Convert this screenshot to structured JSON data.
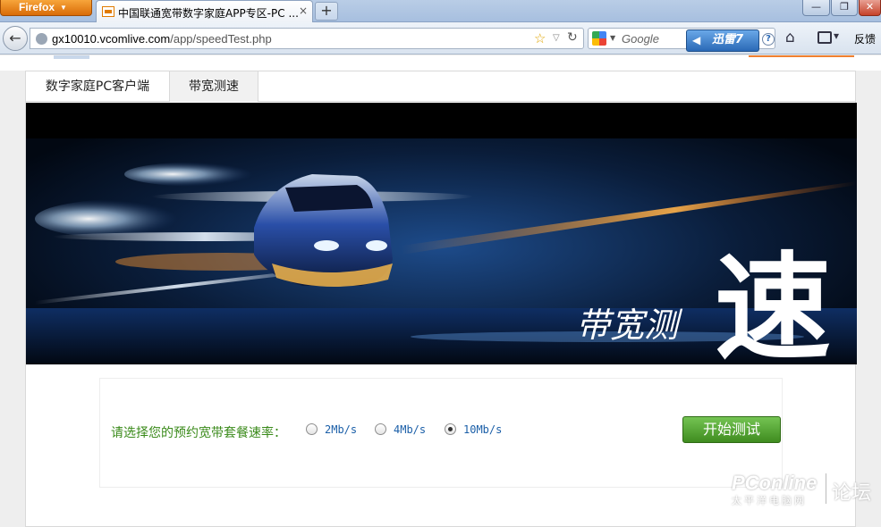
{
  "browser": {
    "app_button": "Firefox",
    "tab_title": "中国联通宽带数字家庭APP专区-PC ...",
    "tab_close": "×",
    "new_tab": "+",
    "url_host": "gx10010.vcomlive.com",
    "url_path": "/app/speedTest.php",
    "search_placeholder": "Google",
    "xunlei_label": "迅雷7",
    "help": "?",
    "feedback": "反馈",
    "window_buttons": {
      "minimize": "—",
      "maximize": "❐",
      "close": "✕"
    }
  },
  "page": {
    "tabs": [
      {
        "label": "数字家庭PC客户端"
      },
      {
        "label": "带宽测速"
      }
    ],
    "banner_caption": "带宽测",
    "banner_big_char": "速",
    "speed": {
      "prompt": "请选择您的预约宽带套餐速率：",
      "options": [
        {
          "label": "2Mb/s",
          "selected": false
        },
        {
          "label": "4Mb/s",
          "selected": false
        },
        {
          "label": "10Mb/s",
          "selected": true
        }
      ],
      "start_button": "开始测试"
    }
  },
  "watermark": {
    "brand": "PConline",
    "sub": "太平洋电脑网",
    "forum": "论坛"
  },
  "colors": {
    "prompt_green": "#3a8a1a",
    "option_blue": "#1b5fa8",
    "button_green": "#4fa22c",
    "firefox_orange": "#e6821a"
  }
}
